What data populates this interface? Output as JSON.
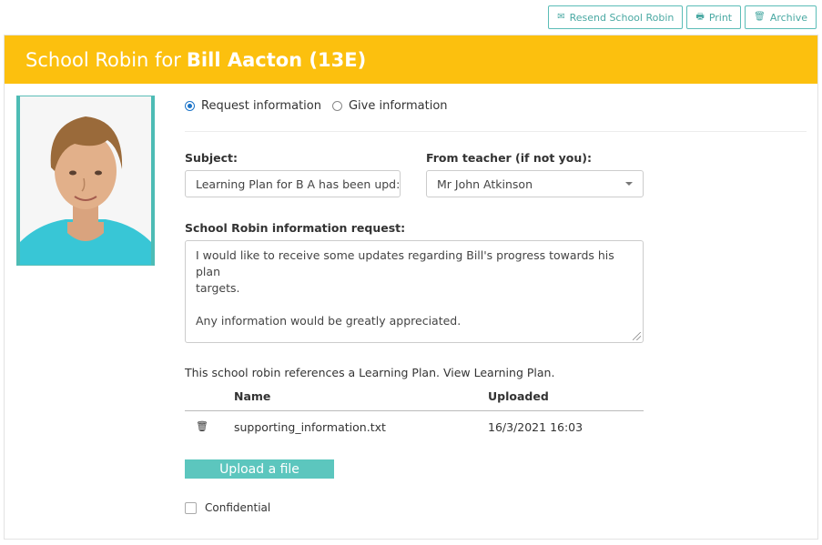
{
  "toolbar": {
    "resend_label": "Resend School Robin",
    "print_label": "Print",
    "archive_label": "Archive"
  },
  "header": {
    "prefix": "School Robin for",
    "student_name": "Bill Aacton (13E)"
  },
  "mode": {
    "options": [
      "Request information",
      "Give information"
    ],
    "selected": "Request information"
  },
  "form": {
    "subject_label": "Subject:",
    "subject_value": "Learning Plan for B A has been upd:",
    "teacher_label": "From teacher (if not you):",
    "teacher_value": "Mr John Atkinson",
    "request_label": "School Robin information request:",
    "request_line1": "I would like to receive some updates regarding Bill's progress towards his plan",
    "request_line2": "targets.",
    "request_line3": "Any information would be greatly appreciated."
  },
  "reference": {
    "text": "This school robin references a Learning Plan.",
    "link": "View Learning Plan."
  },
  "files": {
    "columns": [
      "Name",
      "Uploaded"
    ],
    "rows": [
      {
        "name": "supporting_information.txt",
        "uploaded": "16/3/2021 16:03"
      }
    ],
    "upload_label": "Upload a file"
  },
  "confidential_label": "Confidential",
  "colors": {
    "header_bg": "#fcc00e",
    "accent": "#5cc6be"
  }
}
